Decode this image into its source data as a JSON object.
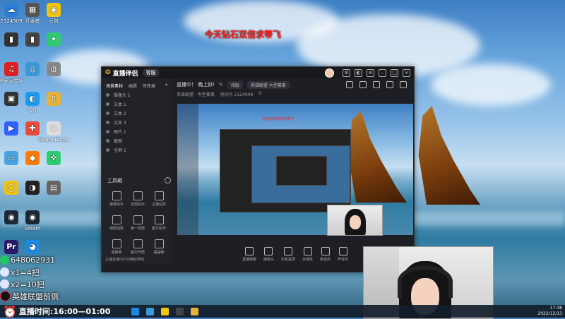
{
  "desktop": {
    "icons": [
      {
        "label": "2124909",
        "color": "#2a7fd4",
        "glyph": "☁"
      },
      {
        "label": "开发者",
        "color": "#555",
        "glyph": "▦"
      },
      {
        "label": "豆包",
        "color": "#f1c40f",
        "glyph": "◉"
      },
      {
        "label": "",
        "color": "#333",
        "glyph": "▮"
      },
      {
        "label": "",
        "color": "#444",
        "glyph": "▮"
      },
      {
        "label": "",
        "color": "#2ecc71",
        "glyph": "✦"
      },
      {
        "label": "网易云音乐",
        "color": "#e02020",
        "glyph": "♫"
      },
      {
        "label": "",
        "color": "#3a9ad9",
        "glyph": "◎"
      },
      {
        "label": "",
        "color": "#888",
        "glyph": "◍"
      },
      {
        "label": "",
        "color": "#333",
        "glyph": "▣"
      },
      {
        "label": "QQ",
        "color": "#1d9bf0",
        "glyph": "◐"
      },
      {
        "label": "",
        "color": "#e8b13a",
        "glyph": "▯"
      },
      {
        "label": "",
        "color": "#3060ff",
        "glyph": "▶"
      },
      {
        "label": "",
        "color": "#e74c3c",
        "glyph": "✚"
      },
      {
        "label": "Game Boost",
        "color": "#ddd",
        "glyph": "◌"
      },
      {
        "label": "",
        "color": "#4aa3df",
        "glyph": "▭"
      },
      {
        "label": "",
        "color": "#ff7a00",
        "glyph": "◆"
      },
      {
        "label": "",
        "color": "#2ecc71",
        "glyph": "✜"
      },
      {
        "label": "",
        "color": "#f1c40f",
        "glyph": "◯"
      },
      {
        "label": "",
        "color": "#222",
        "glyph": "◑"
      },
      {
        "label": "",
        "color": "#666",
        "glyph": "▤"
      },
      {
        "label": "",
        "color": "#1b2838",
        "glyph": "◉"
      },
      {
        "label": "Steam",
        "color": "#1b2838",
        "glyph": "◉"
      },
      {
        "label": "",
        "color": "transparent",
        "glyph": ""
      },
      {
        "label": "",
        "color": "#2c1a6b",
        "glyph": "Pr"
      },
      {
        "label": "",
        "color": "#1e88e5",
        "glyph": "◕"
      }
    ]
  },
  "banner": {
    "text": "今天钻石双倍求带飞"
  },
  "app": {
    "brand": "直播伴侣",
    "badge": "客服",
    "sidebar_tabs": [
      "场景素材",
      "画质",
      "可改类"
    ],
    "sources": [
      "摄像头 1",
      "文本 1",
      "文本 2",
      "文本 3",
      "图片 1",
      "截图",
      "全屏 1"
    ],
    "tools_label": "工具箱",
    "tools": [
      "弹幕助手",
      "音效助手",
      "主播任务",
      "视频连麦",
      "第一视角",
      "图文助手",
      "连弹幕",
      "超市开局",
      "摆摆弹"
    ],
    "sidebar_footer": "主播直播中户为精彩网络",
    "stream_title": "直播中！ 晚上好!",
    "stream_pills": [
      "排版",
      "英雄联盟 大型赛事"
    ],
    "stream_meta": [
      "英雄联盟 · 大型赛事",
      "房间号 2124909",
      "0"
    ],
    "bottom_buttons": [
      "直播弹幕",
      "摄像头",
      "手机投屏",
      "多媒体",
      "麦克风",
      "声音效"
    ]
  },
  "overlay": {
    "wechat": "648062931",
    "line1": "x1=4把",
    "line2": "x2=10把",
    "line3": "英雄联盟前俱"
  },
  "taskbar": {
    "stream_time": "直播时间:16:00—01:00",
    "clock": "17:38",
    "date": "2022/12/13"
  }
}
